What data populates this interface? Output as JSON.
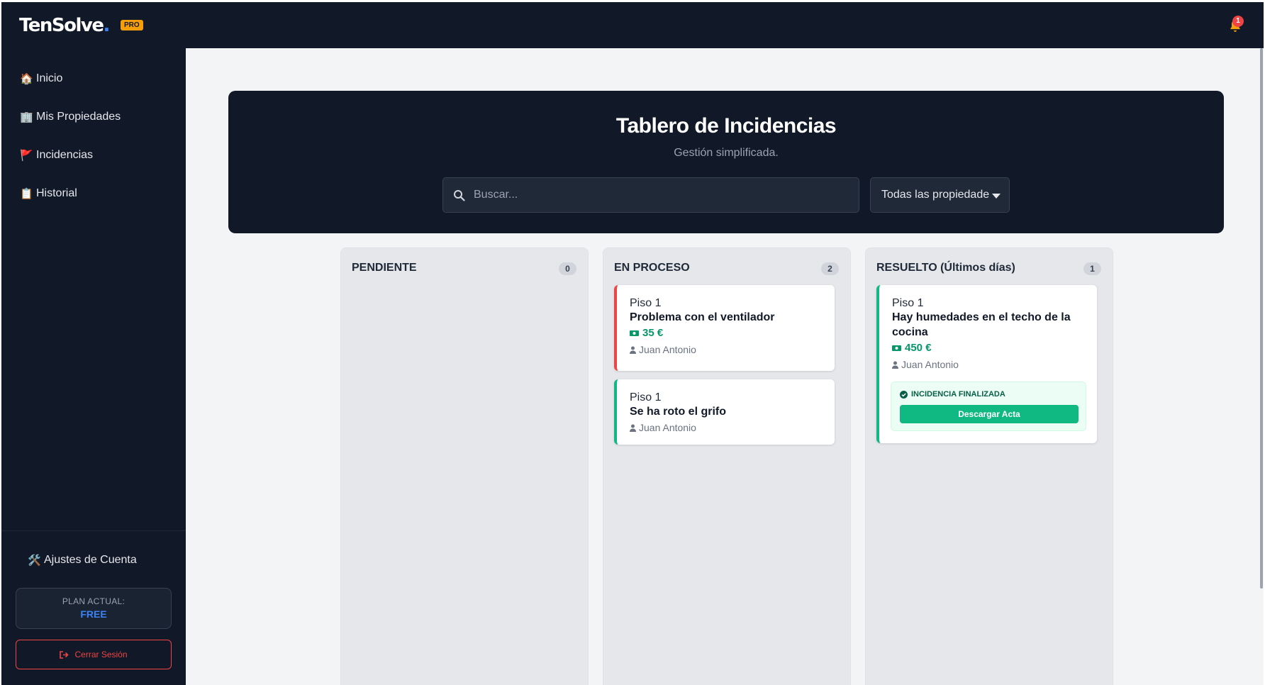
{
  "app": {
    "logo_text": "TenSolve",
    "logo_dot": ".",
    "plan_badge": "PRO",
    "notification_count": "1"
  },
  "sidebar": {
    "items": [
      {
        "icon": "house-icon",
        "emoji": "🏠",
        "label": "Inicio"
      },
      {
        "icon": "building-icon",
        "emoji": "🏢",
        "label": "Mis Propiedades"
      },
      {
        "icon": "flag-icon",
        "emoji": "🚩",
        "label": "Incidencias"
      },
      {
        "icon": "clipboard-icon",
        "emoji": "📋",
        "label": "Historial"
      }
    ],
    "settings": {
      "icon": "tools-icon",
      "emoji": "🛠️",
      "label": "Ajustes de Cuenta"
    },
    "plan": {
      "label": "PLAN ACTUAL:",
      "value": "FREE"
    },
    "logout_label": "Cerrar Sesión"
  },
  "hero": {
    "title": "Tablero de Incidencias",
    "subtitle": "Gestión simplificada.",
    "search_placeholder": "Buscar...",
    "filter_selected": "Todas las propiedade"
  },
  "columns": [
    {
      "title": "PENDIENTE",
      "count": "0",
      "cards": []
    },
    {
      "title": "EN PROCESO",
      "count": "2",
      "cards": [
        {
          "property": "Piso 1",
          "title": "Problema con el ventilador",
          "cost": "35 €",
          "user": "Juan Antonio",
          "status_color": "red"
        },
        {
          "property": "Piso 1",
          "title": "Se ha roto el grifo",
          "cost": "",
          "user": "Juan Antonio",
          "status_color": "green"
        }
      ]
    },
    {
      "title": "RESUELTO (Últimos días)",
      "count": "1",
      "cards": [
        {
          "property": "Piso 1",
          "title": "Hay humedades en el techo de la cocina",
          "cost": "450 €",
          "user": "Juan Antonio",
          "status_color": "green",
          "final_label": "INCIDENCIA FINALIZADA",
          "download_label": "Descargar Acta"
        }
      ]
    }
  ],
  "colors": {
    "dark": "#111827",
    "accent_blue": "#3b82f6",
    "pro_badge": "#f59e0b",
    "danger": "#ef4444",
    "success": "#10b981"
  }
}
